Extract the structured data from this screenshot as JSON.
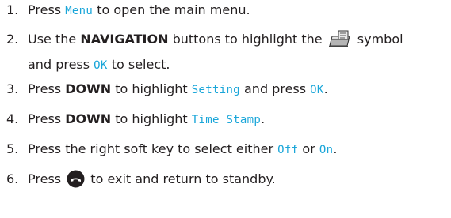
{
  "steps": [
    {
      "num": "1.",
      "parts": [
        "Press ",
        "Menu",
        " to open the main menu."
      ]
    },
    {
      "num": "2.",
      "parts": [
        "Use the ",
        "NAVIGATION",
        " buttons to highlight the ",
        " symbol",
        "and press ",
        "OK",
        " to select."
      ]
    },
    {
      "num": "3.",
      "parts": [
        "Press ",
        "DOWN",
        " to highlight ",
        "Setting",
        " and press ",
        "OK",
        "."
      ]
    },
    {
      "num": "4.",
      "parts": [
        "Press ",
        "DOWN",
        " to highlight ",
        "Time Stamp",
        "."
      ]
    },
    {
      "num": "5.",
      "parts": [
        "Press the right soft key to select either ",
        "Off",
        " or ",
        "On",
        "."
      ]
    },
    {
      "num": "6.",
      "parts": [
        "Press ",
        " to exit and return to standby."
      ]
    }
  ],
  "colors": {
    "lcd_text": "#1aa6d9",
    "body_text": "#231f20"
  },
  "icons": [
    "messages-folder-icon",
    "end-call-key-icon"
  ]
}
